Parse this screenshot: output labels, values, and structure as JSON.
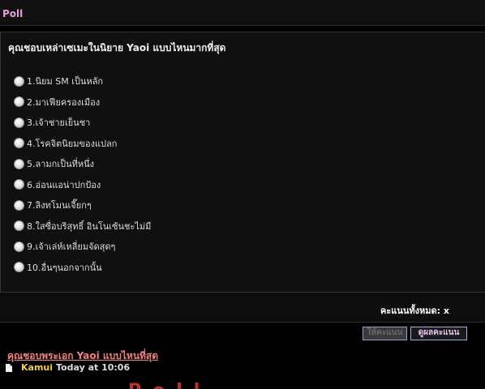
{
  "header": {
    "title": "Poll"
  },
  "poll": {
    "question": "คุณชอบเหล่าเซเมะในนิยาย Yaoi แบบไหนมากที่สุด",
    "options": [
      "1.นิยม SM เป็นหลัก",
      "2.มาเฟียครองเมือง",
      "3.เจ้าชายเย็นชา",
      "4.โรคจิตนิยมของแปลก",
      "5.ลามกเป็นที่หนึ่ง",
      "6.อ่อนแอน่าปกป้อง",
      "7.ลิงทโมนเจี๊ยกๆ",
      "8.ใสซื่อบริสุทธิ์ อินโนเซ้นชะไม่มี",
      "9.เจ้าเล่ห์เหลี่ยมจัดสุดๆ",
      "10.อื่นๆนอกจากนั้น"
    ],
    "total_votes": "คะแนนทั้งหมด: x",
    "vote_button": "ให้คะแนน",
    "results_button": "ดูผลคะแนน"
  },
  "recent": {
    "topic_title": "คุณชอบพระเอก Yaoi แบบไหนที่สุด",
    "author": "Kamui",
    "time": "Today at 10:06"
  },
  "footer_fragment": "Poll"
}
